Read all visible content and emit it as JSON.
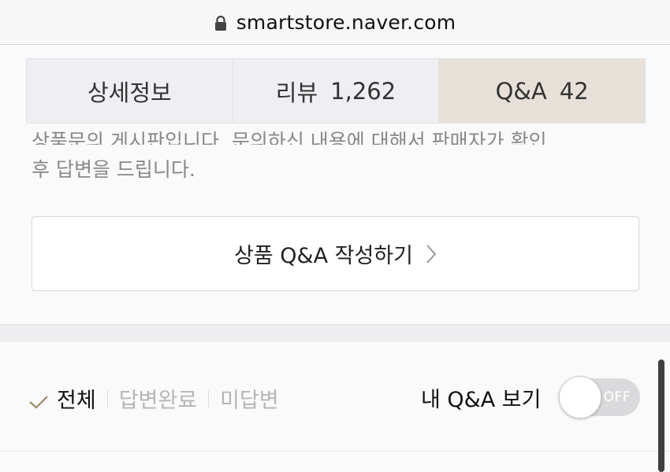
{
  "browser": {
    "url": "smartstore.naver.com"
  },
  "tabs": [
    {
      "label": "상세정보",
      "count": ""
    },
    {
      "label": "리뷰",
      "count": "1,262"
    },
    {
      "label": "Q&A",
      "count": "42"
    }
  ],
  "notice": {
    "partial_line": "상품문의 게시판입니다. 문의하신 내용에 대해서 판매자가 확인",
    "line2": "후 답변을 드립니다."
  },
  "write_button": {
    "label": "상품 Q&A 작성하기"
  },
  "filters": {
    "all": "전체",
    "answered": "답변완료",
    "unanswered": "미답변"
  },
  "my_qa": {
    "label": "내 Q&A 보기",
    "toggle_state": "OFF"
  },
  "colors": {
    "active_tab": "#e7e0d9",
    "tab_bg": "#efeff3",
    "check": "#9a8a6a"
  }
}
